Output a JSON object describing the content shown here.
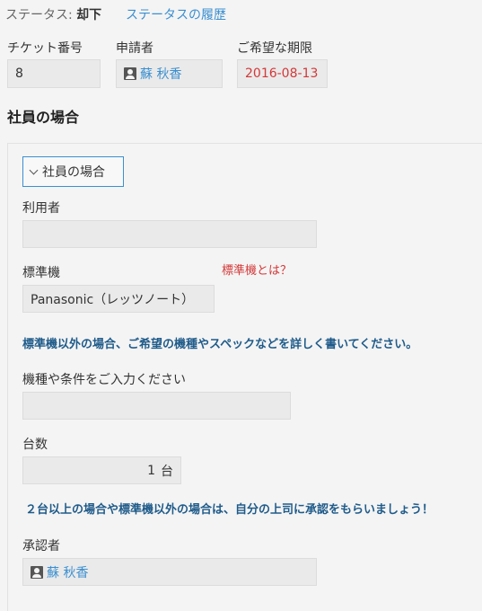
{
  "header": {
    "status_label": "ステータス:",
    "status_value": "却下",
    "history_link": "ステータスの履歴"
  },
  "fields": {
    "ticket_label": "チケット番号",
    "ticket_value": "8",
    "applicant_label": "申請者",
    "applicant_value": "蘇 秋香",
    "deadline_label": "ご希望な期限",
    "deadline_value": "2016-08-13"
  },
  "section": {
    "title": "社員の場合",
    "group_toggle": "社員の場合"
  },
  "form": {
    "user_label": "利用者",
    "user_value": "",
    "standard_label": "標準機",
    "standard_about_link": "標準機とは？",
    "standard_value": "Panasonic（レッツノート）",
    "notice_other_model": "標準機以外の場合、ご希望の機種やスペックなどを詳しく書いてください。",
    "conditions_label": "機種や条件をご入力ください",
    "conditions_value": "",
    "count_label": "台数",
    "count_value": "1",
    "count_unit": "台",
    "notice_approval": "２台以上の場合や標準機以外の場合は、自分の上司に承認をもらいましょう！",
    "approver_label": "承認者",
    "approver_value": "蘇 秋香"
  },
  "colors": {
    "link": "#3b8fd0",
    "deadline": "#d43838",
    "notice": "#1f5b8a"
  },
  "icons": {
    "user": "user-icon",
    "chevron": "chevron-down-icon"
  }
}
